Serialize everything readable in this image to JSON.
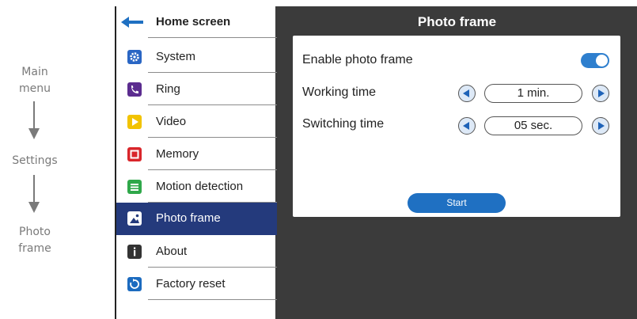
{
  "annotations": {
    "step1": "Main\nmenu",
    "step2": "Settings",
    "step3": "Photo\nframe"
  },
  "sidebar": {
    "header": "Home screen",
    "items": [
      {
        "label": "System",
        "icon": "gear-icon",
        "color": "#2a66c4"
      },
      {
        "label": "Ring",
        "icon": "phone-icon",
        "color": "#5b2c8f"
      },
      {
        "label": "Video",
        "icon": "play-icon",
        "color": "#f2c300"
      },
      {
        "label": "Memory",
        "icon": "memory-icon",
        "color": "#d9262b"
      },
      {
        "label": "Motion detection",
        "icon": "motion-icon",
        "color": "#2fa84a"
      },
      {
        "label": "Photo frame",
        "icon": "photo-icon",
        "color": "#243a7c",
        "selected": true
      },
      {
        "label": "About",
        "icon": "info-icon",
        "color": "#333333"
      },
      {
        "label": "Factory reset",
        "icon": "reset-icon",
        "color": "#1c6bbf"
      }
    ]
  },
  "main": {
    "title": "Photo frame",
    "enable_label": "Enable photo frame",
    "enable_on": true,
    "working_time_label": "Working time",
    "working_time_value": "1 min.",
    "switching_time_label": "Switching time",
    "switching_time_value": "05 sec.",
    "start_label": "Start"
  },
  "colors": {
    "selected_bg": "#243a7c",
    "accent": "#1f70c2",
    "dark_bg": "#3b3b3b"
  }
}
